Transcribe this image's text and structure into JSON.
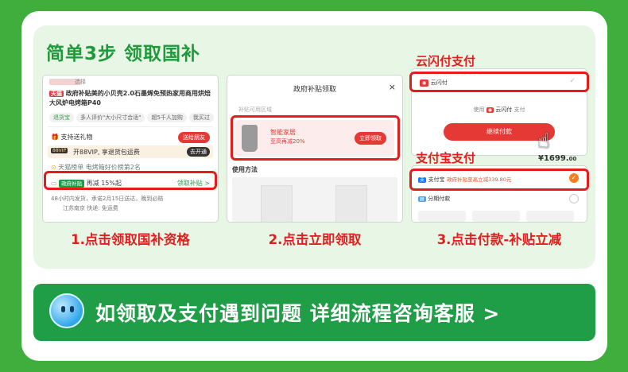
{
  "title": "简单3步 领取国补",
  "steps": [
    {
      "caption": "1.点击领取国补资格"
    },
    {
      "caption": "2.点击立即领取"
    },
    {
      "caption": "3.点击付款-补贴立减"
    }
  ],
  "step1": {
    "select_text": "选择",
    "product_title": "政府补贴美的小贝壳2.0石墨烯免预热家用商用烘焙大风炉电烤箱P40",
    "tmall_badge": "天猫",
    "tags": [
      "退货宝",
      "多人评价\"大小尺寸合适\"",
      "超5千人加购",
      "我买过"
    ],
    "gift_label": "支持送礼物",
    "gift_btn": "送给朋友",
    "vip_text": "开88VIP, 享退货包运费",
    "vip_badge": "88VIP",
    "vip_btn": "去开通",
    "rank_text": "天猫榜单 电烤箱好价榜第2名",
    "subsidy_badge": "政府补贴",
    "subsidy_text": "再减 15%起",
    "subsidy_link": "领取补贴 >",
    "ship_text": "48小时内发货，承诺2月15日送达，晚到必赔",
    "ship_text2": "江苏南京 快递: 免运费"
  },
  "step2": {
    "dialog_title": "政府补贴领取",
    "close": "×",
    "subtitle": "补贴可用区域",
    "category": "智能家居",
    "discount": "至高再减20%",
    "claim_btn": "立即领取",
    "usage_title": "使用方法"
  },
  "step3": {
    "unionpay_label": "云闪付支付",
    "unionpay_option": "云闪付",
    "use_text": "使用",
    "pay_text": "支付",
    "continue_btn": "继续付款",
    "alipay_label": "支付宝支付",
    "price": "¥1699.",
    "price_cents": "00",
    "alipay_option": "支付宝",
    "alipay_promo": "政府补贴至高立减339.80元",
    "installment": "分期付款"
  },
  "footer": {
    "text": "如领取及支付遇到问题 详细流程咨询客服 >"
  },
  "colors": {
    "green": "#3fae3c",
    "title_green": "#1f9a3a",
    "red": "#e51c1c",
    "bottom_green": "#1f9e47"
  }
}
